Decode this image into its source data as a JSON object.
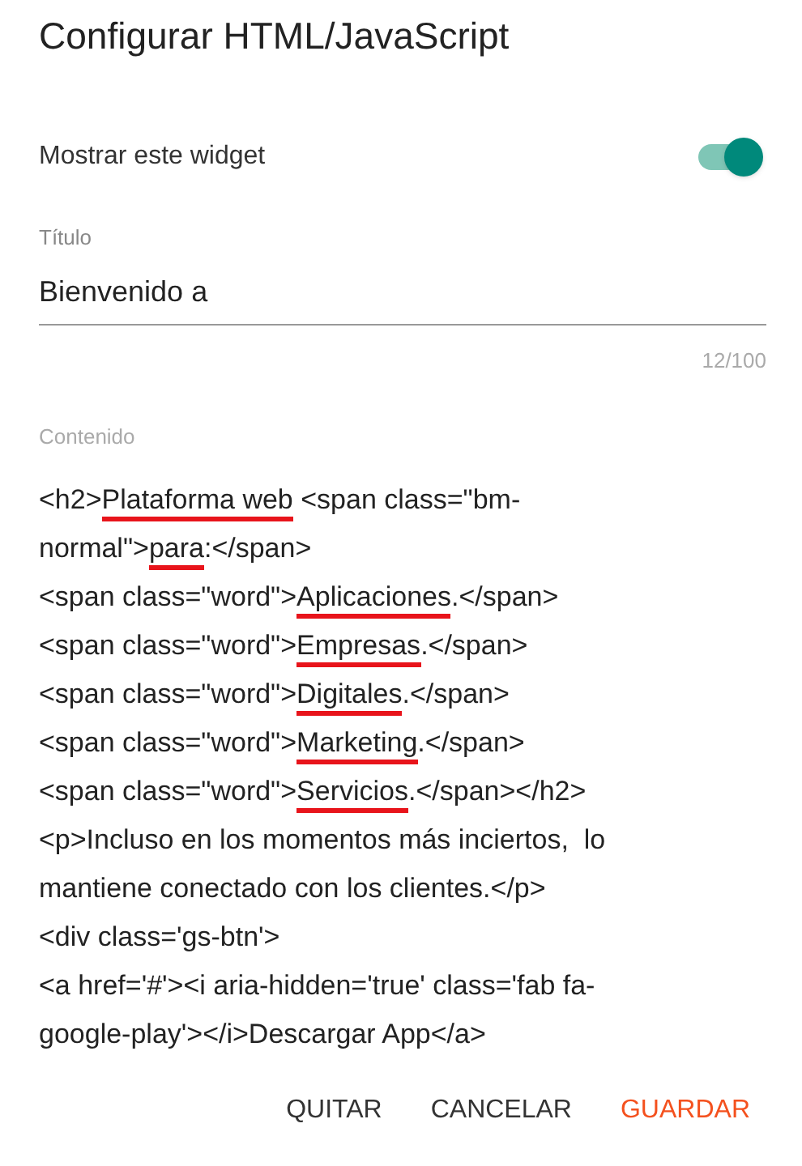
{
  "dialog": {
    "title": "Configurar HTML/JavaScript"
  },
  "show_widget": {
    "label": "Mostrar este widget",
    "on": true
  },
  "title_field": {
    "label": "Título",
    "value": "Bienvenido a",
    "counter": "12/100"
  },
  "content_field": {
    "label": "Contenido",
    "lines": [
      [
        {
          "text": "<h2>",
          "underlined": false
        },
        {
          "text": "Plataforma web",
          "underlined": true
        },
        {
          "text": " <span class=\"bm-",
          "underlined": false
        }
      ],
      [
        {
          "text": "normal\">",
          "underlined": false
        },
        {
          "text": "para",
          "underlined": true
        },
        {
          "text": ":</span>",
          "underlined": false
        }
      ],
      [
        {
          "text": "<span class=\"word\">",
          "underlined": false
        },
        {
          "text": "Aplicaciones",
          "underlined": true
        },
        {
          "text": ".</span>",
          "underlined": false
        }
      ],
      [
        {
          "text": "<span class=\"word\">",
          "underlined": false
        },
        {
          "text": "Empresas",
          "underlined": true
        },
        {
          "text": ".</span>",
          "underlined": false
        }
      ],
      [
        {
          "text": "<span class=\"word\">",
          "underlined": false
        },
        {
          "text": "Digitales",
          "underlined": true
        },
        {
          "text": ".</span>",
          "underlined": false
        }
      ],
      [
        {
          "text": "<span class=\"word\">",
          "underlined": false
        },
        {
          "text": "Marketing",
          "underlined": true
        },
        {
          "text": ".</span>",
          "underlined": false
        }
      ],
      [
        {
          "text": "<span class=\"word\">",
          "underlined": false
        },
        {
          "text": "Servicios",
          "underlined": true
        },
        {
          "text": ".</span></h2>",
          "underlined": false
        }
      ],
      [
        {
          "text": "<p>Incluso en los momentos más inciertos,  lo",
          "underlined": false
        }
      ],
      [
        {
          "text": "mantiene conectado con los clientes.</p>",
          "underlined": false
        }
      ],
      [
        {
          "text": "<div class='gs-btn'>",
          "underlined": false
        }
      ],
      [
        {
          "text": "<a href='#'><i aria-hidden='true' class='fab fa-",
          "underlined": false
        }
      ],
      [
        {
          "text": "google-play'></i>Descargar App</a>",
          "underlined": false
        }
      ]
    ]
  },
  "buttons": [
    {
      "label": "QUITAR",
      "kind": "plain"
    },
    {
      "label": "CANCELAR",
      "kind": "plain"
    },
    {
      "label": "GUARDAR",
      "kind": "primary"
    }
  ]
}
